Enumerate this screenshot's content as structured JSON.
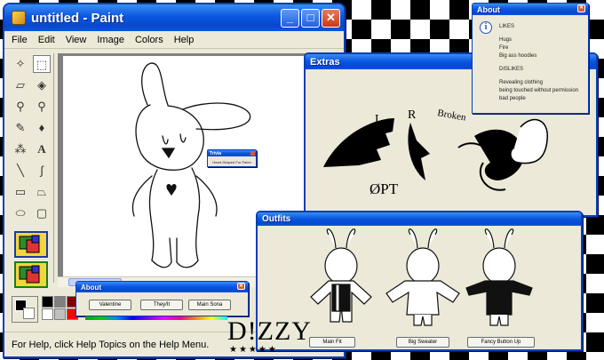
{
  "paint": {
    "title": "untitled - Paint",
    "menu": [
      "File",
      "Edit",
      "View",
      "Image",
      "Colors",
      "Help"
    ],
    "status": "For Help, click Help Topics on the Help Menu.",
    "controls": {
      "minimize": "_",
      "maximize": "□",
      "close": "✕"
    },
    "tools": [
      {
        "name": "free-select-icon",
        "glyph": "✧"
      },
      {
        "name": "rect-select-icon",
        "glyph": "⬚"
      },
      {
        "name": "eraser-icon",
        "glyph": "▱"
      },
      {
        "name": "fill-icon",
        "glyph": "◈"
      },
      {
        "name": "color-picker-icon",
        "glyph": "⚲"
      },
      {
        "name": "magnifier-icon",
        "glyph": "⚲"
      },
      {
        "name": "pencil-icon",
        "glyph": "✎"
      },
      {
        "name": "brush-icon",
        "glyph": "♦"
      },
      {
        "name": "airbrush-icon",
        "glyph": "⁂"
      },
      {
        "name": "text-icon",
        "glyph": "A"
      },
      {
        "name": "line-icon",
        "glyph": "╲"
      },
      {
        "name": "curve-icon",
        "glyph": "∫"
      },
      {
        "name": "rectangle-icon",
        "glyph": "▭"
      },
      {
        "name": "polygon-icon",
        "glyph": "⏢"
      },
      {
        "name": "ellipse-icon",
        "glyph": "⬭"
      },
      {
        "name": "rounded-rect-icon",
        "glyph": "▢"
      }
    ],
    "palette_colors": [
      "#000000",
      "#808080",
      "#800000",
      "#808000",
      "#008000",
      "#008080",
      "#000080",
      "#800080",
      "#ffffff",
      "#c0c0c0",
      "#ff0000",
      "#ffff00",
      "#00ff00",
      "#00ffff",
      "#0000ff",
      "#ff00ff"
    ]
  },
  "trivia": {
    "title": "Trivia",
    "text": "Heart-Shaped Fur Patch"
  },
  "about_small": {
    "title": "About",
    "buttons": [
      "Valentine",
      "They/It",
      "Main Sona"
    ]
  },
  "about_right": {
    "title": "About",
    "likes_heading": "LIKES",
    "likes": [
      "Hugs",
      "Fire",
      "Big ass hoodies"
    ],
    "dislikes_heading": "DISLIKES",
    "dislikes": [
      "Revealing clothing",
      "being touched without permission",
      "bad people"
    ]
  },
  "extras": {
    "title": "Extras",
    "labels": [
      "L",
      "R",
      "Broken",
      "ØPT"
    ]
  },
  "outfits": {
    "title": "Outfits",
    "buttons": [
      "Main Fit",
      "Big Sweater",
      "Fancy Button Up"
    ]
  },
  "signature": "D!ZZY"
}
